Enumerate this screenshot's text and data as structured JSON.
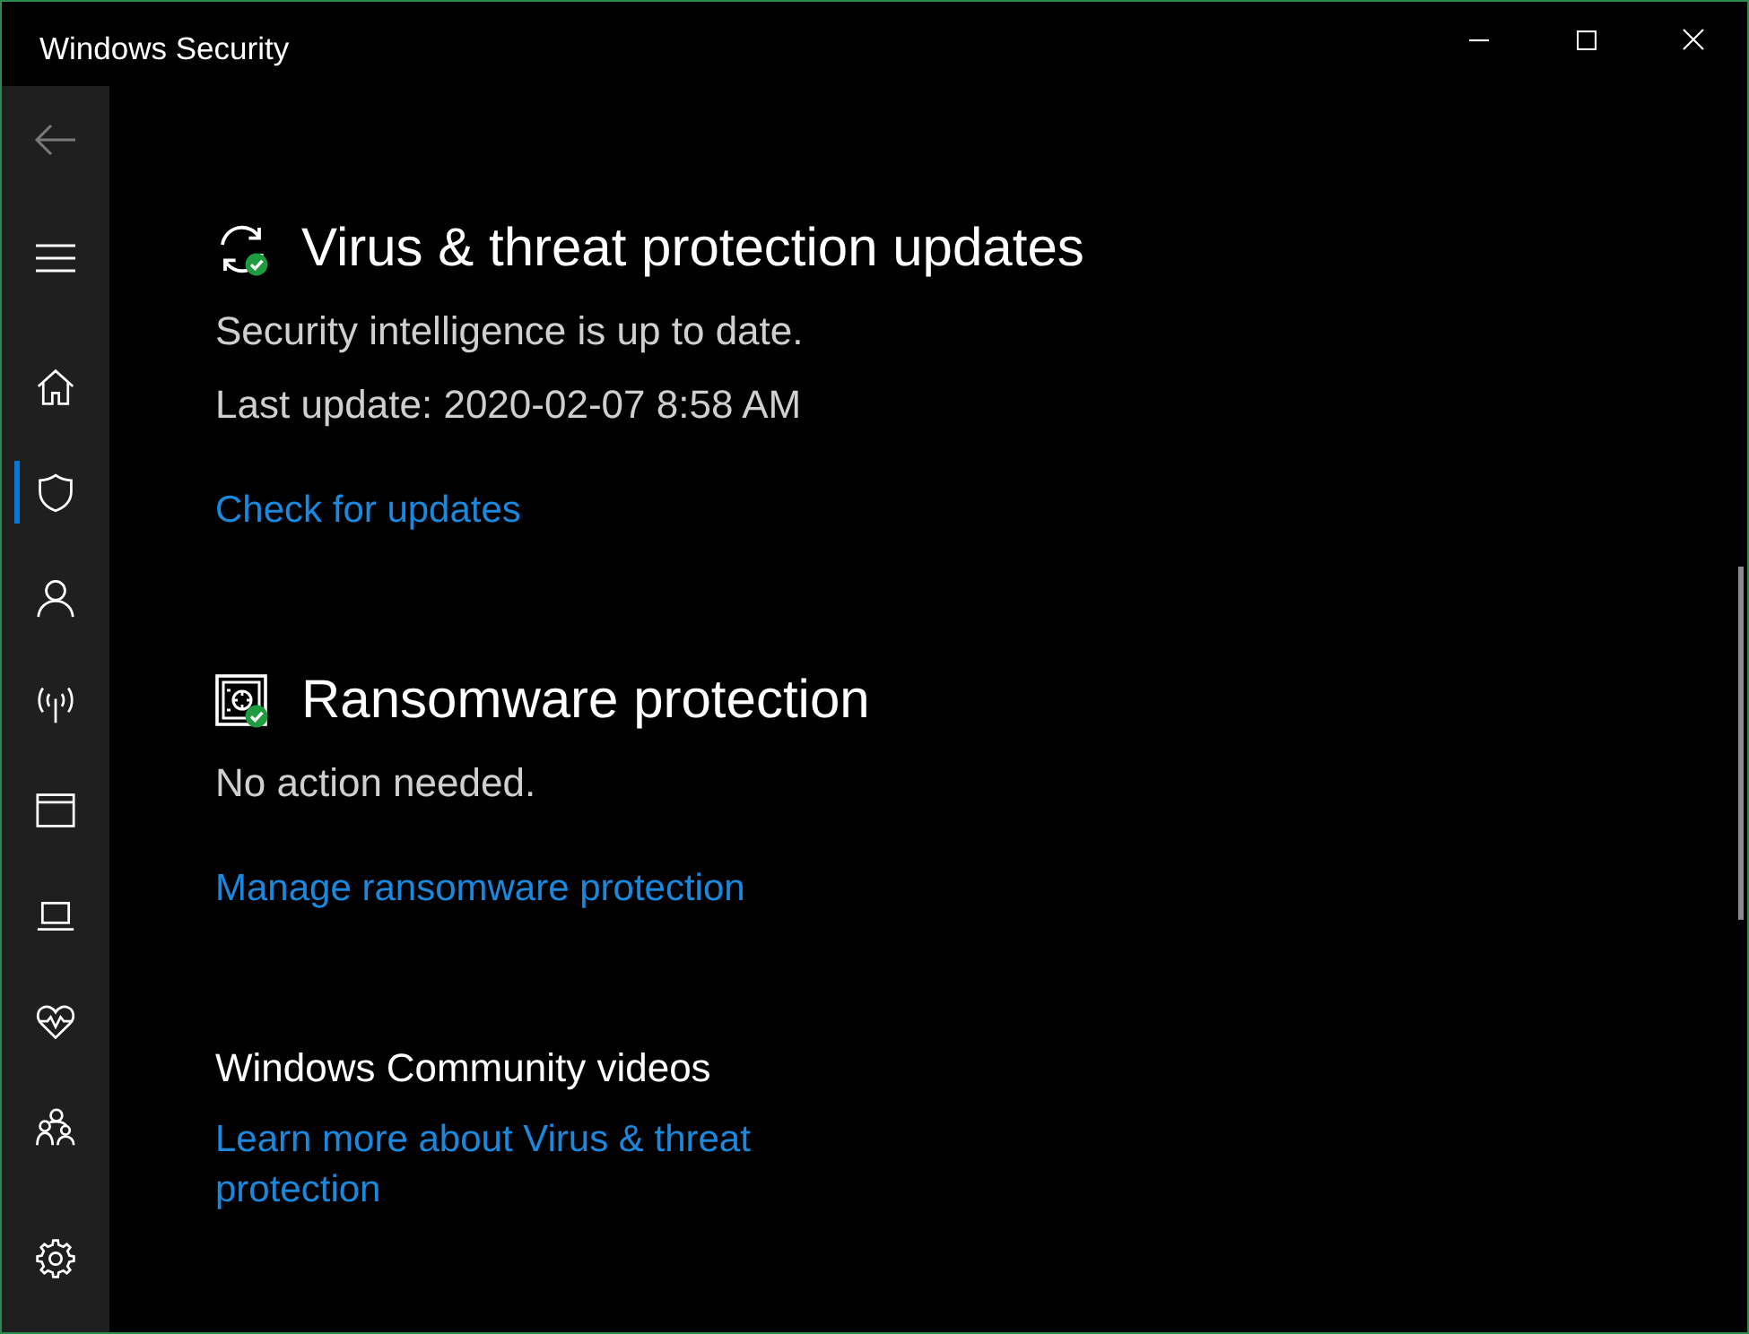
{
  "window": {
    "title": "Windows Security"
  },
  "sidebar": {
    "back": {
      "disabled": true
    },
    "items": [
      {
        "kind": "home",
        "selected": false
      },
      {
        "kind": "shield",
        "selected": true
      },
      {
        "kind": "account",
        "selected": false
      },
      {
        "kind": "network",
        "selected": false
      },
      {
        "kind": "app",
        "selected": false
      },
      {
        "kind": "device",
        "selected": false
      },
      {
        "kind": "health",
        "selected": false
      },
      {
        "kind": "family",
        "selected": false
      },
      {
        "kind": "settings",
        "selected": false
      }
    ]
  },
  "sections": [
    {
      "kind": "updates",
      "protected": true,
      "title": "Virus & threat protection updates",
      "lines": [
        "Security intelligence is up to date.",
        "Last update: 2020-02-07 8:58 AM"
      ],
      "link": "Check for updates"
    },
    {
      "kind": "ransomware",
      "protected": true,
      "title": "Ransomware protection",
      "lines": [
        "No action needed."
      ],
      "link": "Manage ransomware protection"
    }
  ],
  "community": {
    "heading": "Windows Community videos",
    "link": "Learn more about Virus & threat protection"
  }
}
